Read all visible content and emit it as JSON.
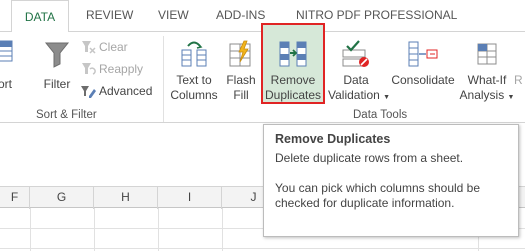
{
  "tabs": [
    "DATA",
    "REVIEW",
    "VIEW",
    "ADD-INS",
    "NITRO PDF PROFESSIONAL"
  ],
  "sort_filter": {
    "sort_label": "ort",
    "filter_label": "Filter",
    "clear_label": "Clear",
    "reapply_label": "Reapply",
    "advanced_label": "Advanced",
    "group_label": "Sort & Filter"
  },
  "data_tools": {
    "text_to_columns": [
      "Text to",
      "Columns"
    ],
    "flash_fill": [
      "Flash",
      "Fill"
    ],
    "remove_duplicates": [
      "Remove",
      "Duplicates"
    ],
    "data_validation": [
      "Data",
      "Validation"
    ],
    "consolidate": "Consolidate",
    "what_if": [
      "What-If",
      "Analysis"
    ],
    "cutoff_label": "R",
    "group_label": "Data Tools"
  },
  "tooltip": {
    "title": "Remove Duplicates",
    "description": "Delete duplicate rows from a sheet.",
    "detail": "You can pick which columns should be checked for duplicate information."
  },
  "columns": [
    "F",
    "G",
    "H",
    "I",
    "J",
    "N"
  ],
  "colors": {
    "accent": "#217346",
    "highlight_border": "#e02424",
    "button_hover": "#d6e8d8"
  }
}
